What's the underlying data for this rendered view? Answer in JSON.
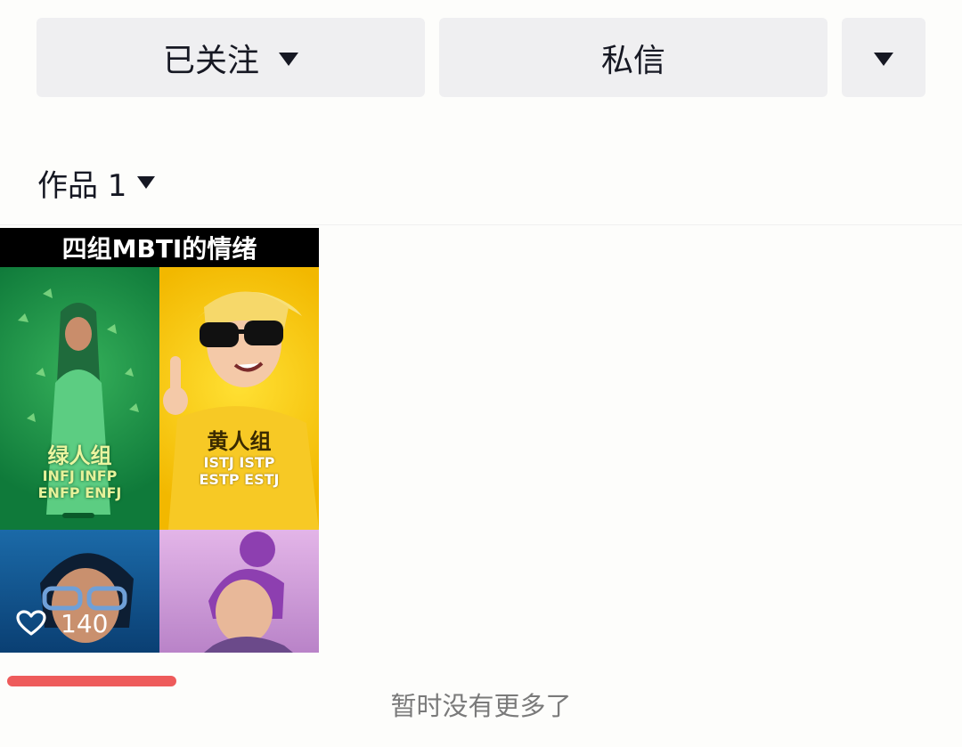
{
  "actions": {
    "follow_label": "已关注",
    "message_label": "私信"
  },
  "works_tab": {
    "label": "作品 1"
  },
  "video": {
    "title": "四组MBTI的情绪",
    "groups": [
      {
        "name": "绿人组",
        "types_line1": "INFJ INFP",
        "types_line2": "ENFP ENFJ"
      },
      {
        "name": "黄人组",
        "types_line1": "ISTJ ISTP",
        "types_line2": "ESTP ESTJ"
      }
    ],
    "likes": "140"
  },
  "footer": {
    "no_more": "暂时没有更多了"
  },
  "colors": {
    "button_bg": "#efeff1",
    "underline": "#ee5b5b"
  }
}
